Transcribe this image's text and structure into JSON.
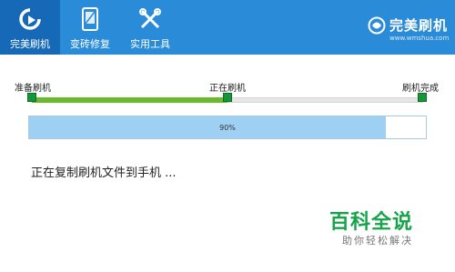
{
  "nav": {
    "tabs": [
      {
        "label": "完美刷机",
        "icon": "refresh-arrow-icon",
        "active": true
      },
      {
        "label": "变砖修复",
        "icon": "phone-repair-icon",
        "active": false
      },
      {
        "label": "实用工具",
        "icon": "tools-icon",
        "active": false
      }
    ]
  },
  "brand": {
    "name": "完美刷机",
    "url": "www.wmshua.com",
    "icon": "shield-logo-icon"
  },
  "steps": {
    "labels": [
      "准备刷机",
      "正在刷机",
      "刷机完成"
    ],
    "current_step": 2,
    "total_steps": 3
  },
  "progress": {
    "value": 0.9,
    "text": "90%"
  },
  "status": {
    "message": "正在复制刷机文件到手机 ..."
  },
  "watermark": {
    "title": "百科全说",
    "subtitle": "助你轻松解决"
  },
  "colors": {
    "titlebar": "#2a8bd8",
    "active_tab": "#1669b6",
    "step_fill": "#6aba2e",
    "step_node": "#16963a",
    "progress_fill": "#9ed0f4",
    "watermark": "#16a34a"
  }
}
